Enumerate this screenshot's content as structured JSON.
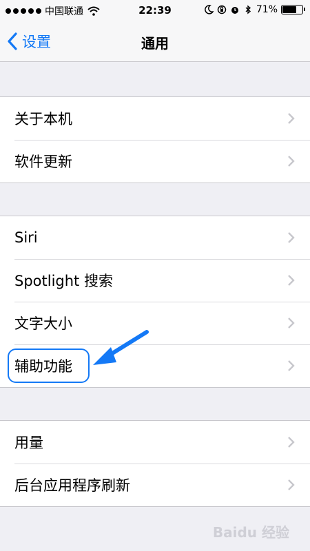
{
  "status": {
    "carrier": "中国联通",
    "time": "22:39",
    "battery": "71%",
    "battery_level": 0.71
  },
  "nav": {
    "back_label": "设置",
    "title": "通用"
  },
  "groups": [
    {
      "items": [
        {
          "label": "关于本机"
        },
        {
          "label": "软件更新"
        }
      ]
    },
    {
      "items": [
        {
          "label": "Siri"
        },
        {
          "label": "Spotlight 搜索"
        },
        {
          "label": "文字大小"
        },
        {
          "label": "辅助功能"
        }
      ]
    },
    {
      "items": [
        {
          "label": "用量"
        },
        {
          "label": "后台应用程序刷新"
        }
      ]
    }
  ],
  "annotation": {
    "color": "#1479f6",
    "target": "辅助功能"
  },
  "watermark": "Baidu 经验"
}
